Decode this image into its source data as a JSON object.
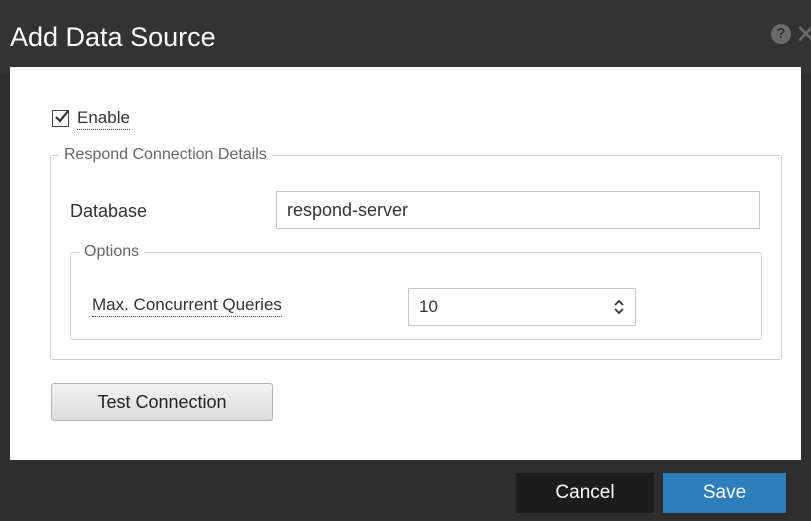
{
  "dialog": {
    "title": "Add Data Source",
    "help_icon": "help-icon",
    "close_icon": "close-icon"
  },
  "enable": {
    "label": "Enable",
    "checked": true
  },
  "connection": {
    "legend": "Respond Connection Details",
    "database_label": "Database",
    "database_value": "respond-server"
  },
  "options": {
    "legend": "Options",
    "max_queries_label": "Max. Concurrent Queries",
    "max_queries_value": "10"
  },
  "buttons": {
    "test_connection": "Test Connection",
    "cancel": "Cancel",
    "save": "Save"
  },
  "colors": {
    "titlebar": "#333333",
    "footer": "#2e2e2e",
    "cancel": "#1c1c1c",
    "save": "#2c7fb8"
  }
}
